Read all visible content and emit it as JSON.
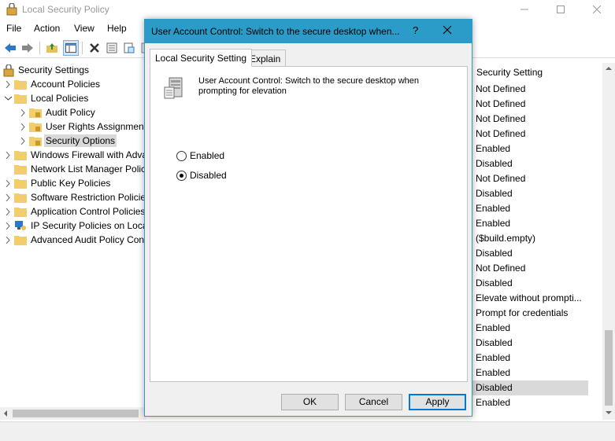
{
  "window": {
    "title": "Local Security Policy"
  },
  "menu": [
    "File",
    "Action",
    "View",
    "Help"
  ],
  "tree": {
    "root": "Security Settings",
    "items": [
      {
        "label": "Account Policies"
      },
      {
        "label": "Local Policies"
      },
      {
        "label": "Audit Policy"
      },
      {
        "label": "User Rights Assignment"
      },
      {
        "label": "Security Options"
      },
      {
        "label": "Windows Firewall with Advanced Security"
      },
      {
        "label": "Network List Manager Policies"
      },
      {
        "label": "Public Key Policies"
      },
      {
        "label": "Software Restriction Policies"
      },
      {
        "label": "Application Control Policies"
      },
      {
        "label": "IP Security Policies on Local Computer"
      },
      {
        "label": "Advanced Audit Policy Configuration"
      }
    ]
  },
  "column_header": "Security Setting",
  "settings": [
    "Not Defined",
    "Not Defined",
    "Not Defined",
    "Not Defined",
    "Enabled",
    "Disabled",
    "Not Defined",
    "Disabled",
    "Enabled",
    "Enabled",
    "($build.empty)",
    "Disabled",
    "Not Defined",
    "Disabled",
    "Elevate without prompti...",
    "Prompt for credentials",
    "Enabled",
    "Disabled",
    "Enabled",
    "Enabled",
    "Disabled",
    "Enabled"
  ],
  "dialog": {
    "title": "User Account Control: Switch to the secure desktop when...",
    "help_glyph": "?",
    "tabs": [
      "Local Security Setting",
      "Explain"
    ],
    "policy_line1": "User Account Control: Switch to the secure desktop when",
    "policy_line2": "prompting for elevation",
    "options": {
      "enabled": "Enabled",
      "disabled": "Disabled",
      "selected": "Disabled"
    },
    "buttons": {
      "ok": "OK",
      "cancel": "Cancel",
      "apply": "Apply"
    }
  },
  "colors": {
    "dialog_accent": "#2b9bc8",
    "selection": "#d9d9d9",
    "default_button_border": "#0078d7"
  }
}
